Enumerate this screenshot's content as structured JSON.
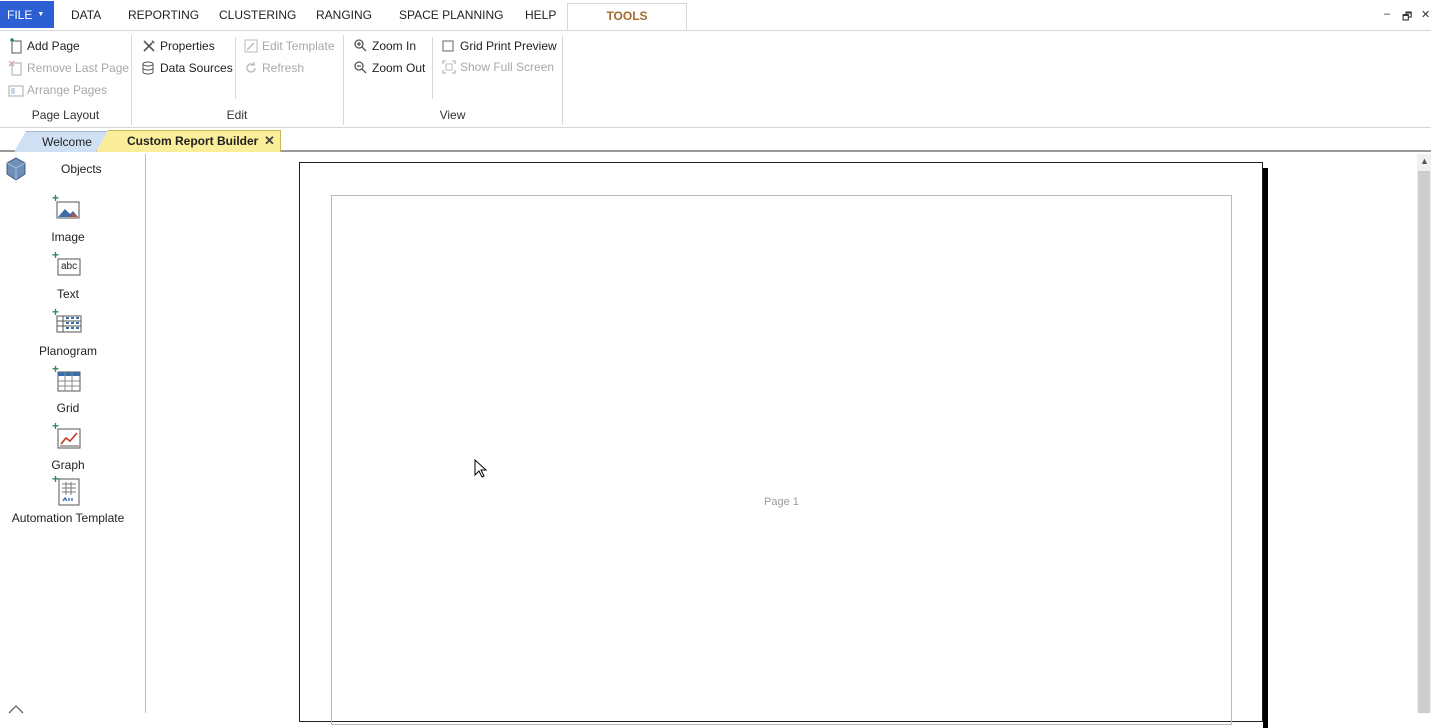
{
  "menu": {
    "file": "FILE",
    "items": [
      "DATA",
      "REPORTING",
      "CLUSTERING",
      "RANGING",
      "SPACE PLANNING",
      "HELP"
    ],
    "active": "TOOLS"
  },
  "window_controls": {
    "minimize": "–",
    "restore": "🗗",
    "close": "✕"
  },
  "ribbon": {
    "page_layout": {
      "label": "Page Layout",
      "add_page": "Add Page",
      "remove_last_page": "Remove Last Page",
      "arrange_pages": "Arrange Pages"
    },
    "edit": {
      "label": "Edit",
      "properties": "Properties",
      "data_sources": "Data Sources",
      "edit_template": "Edit Template",
      "refresh": "Refresh"
    },
    "view": {
      "label": "View",
      "zoom_in": "Zoom In",
      "zoom_out": "Zoom Out",
      "grid_print_preview": "Grid Print Preview",
      "grid_print_preview_checked": false,
      "show_full_screen": "Show Full Screen"
    }
  },
  "tabs": {
    "welcome": "Welcome",
    "active": "Custom Report Builder",
    "close": "✕"
  },
  "objects_panel": {
    "title": "Objects",
    "items": [
      "Image",
      "Text",
      "Planogram",
      "Grid",
      "Graph",
      "Automation Template"
    ],
    "text_icon_glyph": "abc"
  },
  "canvas": {
    "page_label": "Page 1"
  },
  "colors": {
    "file_menu_bg": "#2b5fd3",
    "tools_tab_text": "#a36a2a",
    "active_tab_bg": "#fbee9b",
    "welcome_tab_bg": "#cfe0f5"
  }
}
